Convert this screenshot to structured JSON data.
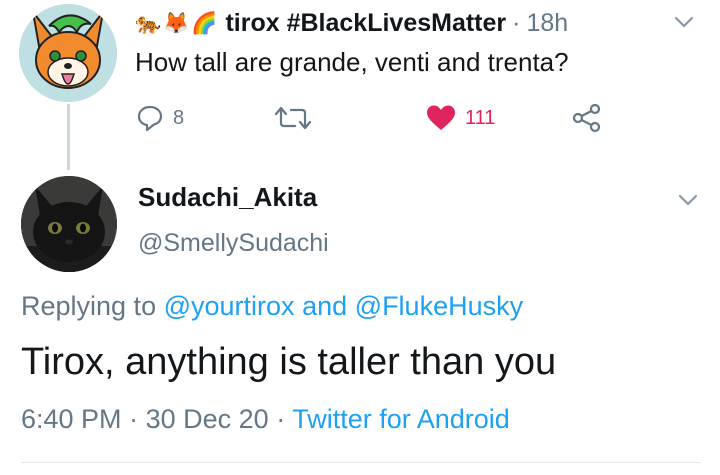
{
  "parent_tweet": {
    "emojis": [
      "🐅",
      "🦊",
      "🌈"
    ],
    "author": "tirox #BlackLivesMatter",
    "separator": "·",
    "time": "18h",
    "text": "How tall are grande, venti and trenta?",
    "reply_count": "8",
    "like_count": "111"
  },
  "reply_tweet": {
    "author": "Sudachi_Akita",
    "handle": "@SmellySudachi",
    "replying_prefix": "Replying to",
    "mention_1": "@yourtirox",
    "replying_and": "and",
    "mention_2": "@FlukeHusky",
    "text": "Tirox, anything is taller than you",
    "time": "6:40 PM",
    "separator_1": "·",
    "date": "30 Dec 20",
    "separator_2": "·",
    "source": "Twitter for Android"
  },
  "colors": {
    "text": "#14171a",
    "muted": "#657786",
    "link": "#1da1f2",
    "like": "#e0245e",
    "thread_line": "#ccd6dd"
  },
  "icons": {
    "reply": "reply-icon",
    "retweet": "retweet-icon",
    "like": "heart-icon",
    "share": "share-icon",
    "menu": "chevron-down-icon"
  }
}
